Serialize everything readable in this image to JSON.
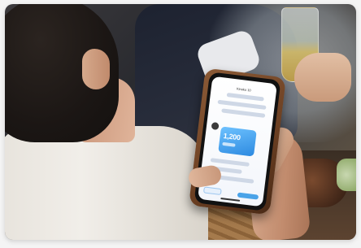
{
  "photo": {
    "screen_title": "Kinoko 10",
    "amount_text": "1,200"
  },
  "colors": {
    "phone_case": "#6b3f22",
    "screen_card": "#2d8ae0",
    "shirt": "#e7e3dc",
    "beer": "#c9b46a"
  },
  "icons": {
    "avatar": "circle-avatar-icon"
  }
}
